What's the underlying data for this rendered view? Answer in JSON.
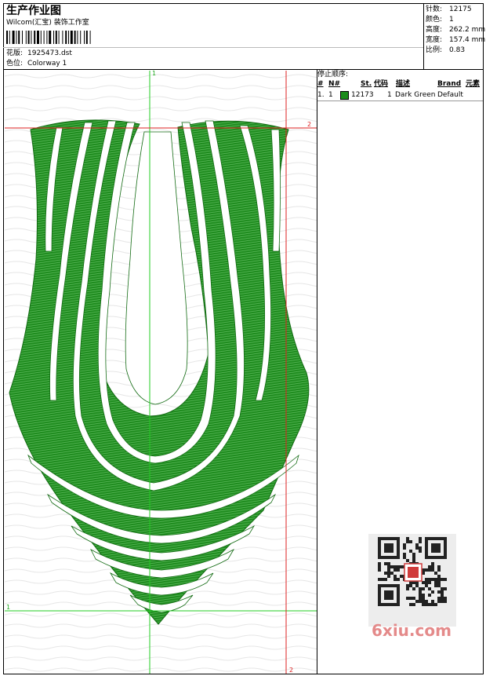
{
  "header": {
    "title": "生产作业图",
    "studio": "Wilcom(汇宝) 装饰工作室",
    "design_label": "花版:",
    "design_value": "1925473.dst",
    "colorway_label": "色位:",
    "colorway_value": "Colorway 1"
  },
  "stats": [
    {
      "label": "针数:",
      "value": "12175"
    },
    {
      "label": "颜色:",
      "value": "1"
    },
    {
      "label": "高度:",
      "value": "262.2 mm"
    },
    {
      "label": "宽度:",
      "value": "157.4 mm"
    },
    {
      "label": "比例:",
      "value": "0.83"
    }
  ],
  "stop_sequence": {
    "title": "停止顺序:",
    "headers": {
      "hash": "#",
      "n": "N#",
      "st": "St.",
      "code": "代码",
      "desc": "描述",
      "brand": "Brand",
      "element": "元素"
    },
    "rows": [
      {
        "hash": "1.",
        "n": "1",
        "color": "#1a8c1a",
        "st": "12173",
        "code": "1",
        "desc": "Dark Green",
        "brand": "Default",
        "element": ""
      }
    ]
  },
  "guides": {
    "green_vertical_label": "1",
    "green_horizontal_label": "1",
    "red_horizontal_label": "2",
    "red_vertical_label": "2",
    "green_color": "#22cc22",
    "red_color": "#dd2222"
  },
  "design": {
    "thread_color": "#1f8c1f",
    "stroke_color": "#136b13"
  },
  "watermark": {
    "text": "6xiu.com"
  }
}
